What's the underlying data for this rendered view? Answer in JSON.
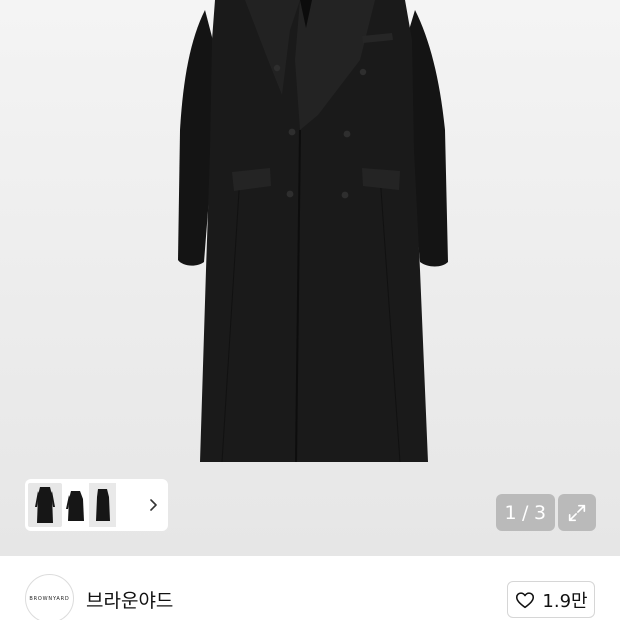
{
  "product_image": {
    "alt": "black double-breasted long coat",
    "background": "#ebebeb",
    "coat_color": "#181818"
  },
  "gallery": {
    "current": "1",
    "separator": "/",
    "total": "3",
    "expand_icon": "expand-arrows-icon",
    "thumbnail_arrow_icon": "chevron-right-icon"
  },
  "store": {
    "logo_text": "BROWNYARD",
    "name": "브라운야드"
  },
  "like": {
    "icon": "heart-outline-icon",
    "count": "1.9만"
  }
}
